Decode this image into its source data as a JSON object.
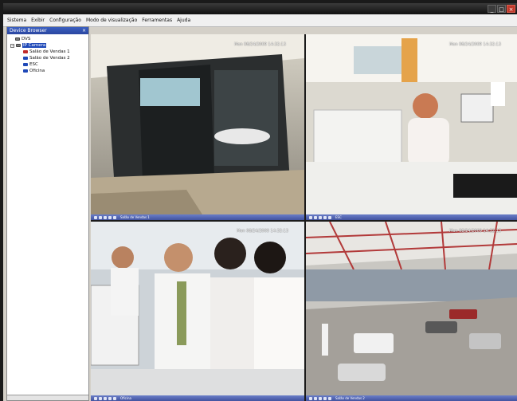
{
  "menu": {
    "items": [
      "Sistema",
      "Exibir",
      "Configuração",
      "Modo de visualização",
      "Ferramentas",
      "Ajuda"
    ]
  },
  "window_controls": [
    "_",
    "□",
    "×"
  ],
  "device_browser": {
    "title": "Device Browser",
    "close": "×",
    "tree": [
      {
        "label": "DVS",
        "level": 1,
        "icon": "dvr-icon"
      },
      {
        "label": "IP Camera",
        "level": 1,
        "icon": "camera-icon",
        "expanded": true,
        "selected": true
      },
      {
        "label": "Salão de Vendas 1",
        "level": 2,
        "icon": "camera-icon"
      },
      {
        "label": "Salão de Vendas 2",
        "level": 2,
        "icon": "camera-icon"
      },
      {
        "label": "ESC",
        "level": 2,
        "icon": "camera-icon"
      },
      {
        "label": "Oficina",
        "level": 2,
        "icon": "camera-icon"
      }
    ]
  },
  "cameras": [
    {
      "timestamp": "Mon 08/24/2009 14:32:13",
      "label": "Salão de Vendas 1",
      "active": true
    },
    {
      "timestamp": "Mon 08/24/2009 14:32:13",
      "label": "ESC",
      "active": false
    },
    {
      "timestamp": "Mon 08/24/2009 14:32:13",
      "label": "Oficina",
      "active": false
    },
    {
      "timestamp": "Mon 08/24/2009 14:32:13",
      "label": "Salão de Vendas 2",
      "active": false
    }
  ],
  "colors": {
    "toolbar": "#4e62b0",
    "active_border": "#c64bb3",
    "selection": "#1f49b8"
  }
}
